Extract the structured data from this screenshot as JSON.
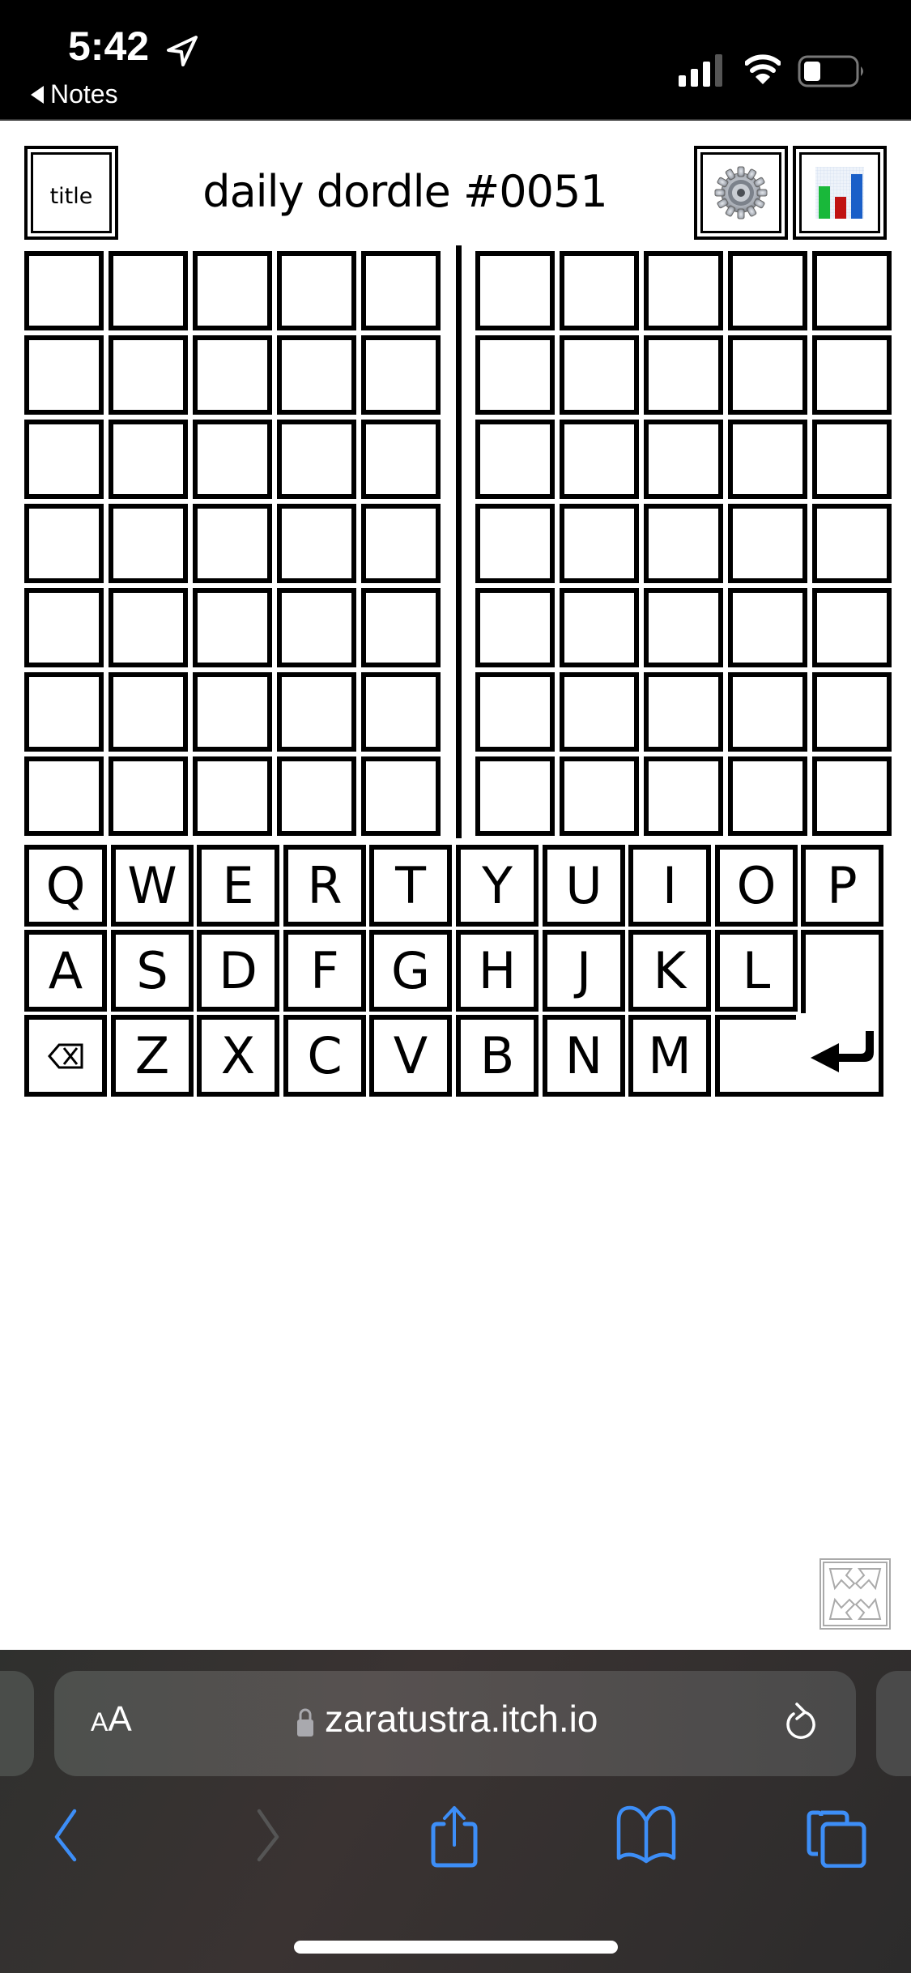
{
  "status_bar": {
    "time": "5:42",
    "back_app": "Notes",
    "icons": [
      "location-arrow-icon",
      "signal-icon",
      "wifi-icon",
      "battery-icon"
    ]
  },
  "header": {
    "title_button": "title",
    "game_title": "daily dordle #0051",
    "settings_icon": "gear-icon",
    "stats_icon": "bar-chart-icon"
  },
  "boards": {
    "count": 2,
    "rows": 7,
    "cols": 5,
    "left": [
      [
        "",
        "",
        "",
        "",
        ""
      ],
      [
        "",
        "",
        "",
        "",
        ""
      ],
      [
        "",
        "",
        "",
        "",
        ""
      ],
      [
        "",
        "",
        "",
        "",
        ""
      ],
      [
        "",
        "",
        "",
        "",
        ""
      ],
      [
        "",
        "",
        "",
        "",
        ""
      ],
      [
        "",
        "",
        "",
        "",
        ""
      ]
    ],
    "right": [
      [
        "",
        "",
        "",
        "",
        ""
      ],
      [
        "",
        "",
        "",
        "",
        ""
      ],
      [
        "",
        "",
        "",
        "",
        ""
      ],
      [
        "",
        "",
        "",
        "",
        ""
      ],
      [
        "",
        "",
        "",
        "",
        ""
      ],
      [
        "",
        "",
        "",
        "",
        ""
      ],
      [
        "",
        "",
        "",
        "",
        ""
      ]
    ]
  },
  "keyboard": {
    "row1": [
      "Q",
      "W",
      "E",
      "R",
      "T",
      "Y",
      "U",
      "I",
      "O",
      "P"
    ],
    "row2": [
      "A",
      "S",
      "D",
      "F",
      "G",
      "H",
      "J",
      "K",
      "L"
    ],
    "row3": [
      "Z",
      "X",
      "C",
      "V",
      "B",
      "N",
      "M"
    ],
    "backspace_icon": "backspace-icon",
    "enter_icon": "enter-arrow-icon"
  },
  "fullscreen_icon": "fullscreen-expand-icon",
  "browser": {
    "text_size_label_small": "A",
    "text_size_label_large": "A",
    "url": "zaratustra.itch.io",
    "lock_icon": "lock-icon",
    "reload_icon": "reload-icon",
    "toolbar": [
      "back-icon",
      "forward-icon",
      "share-icon",
      "bookmarks-icon",
      "tabs-icon"
    ],
    "accent_color": "#3d8ef7",
    "disabled_color": "#555555"
  }
}
